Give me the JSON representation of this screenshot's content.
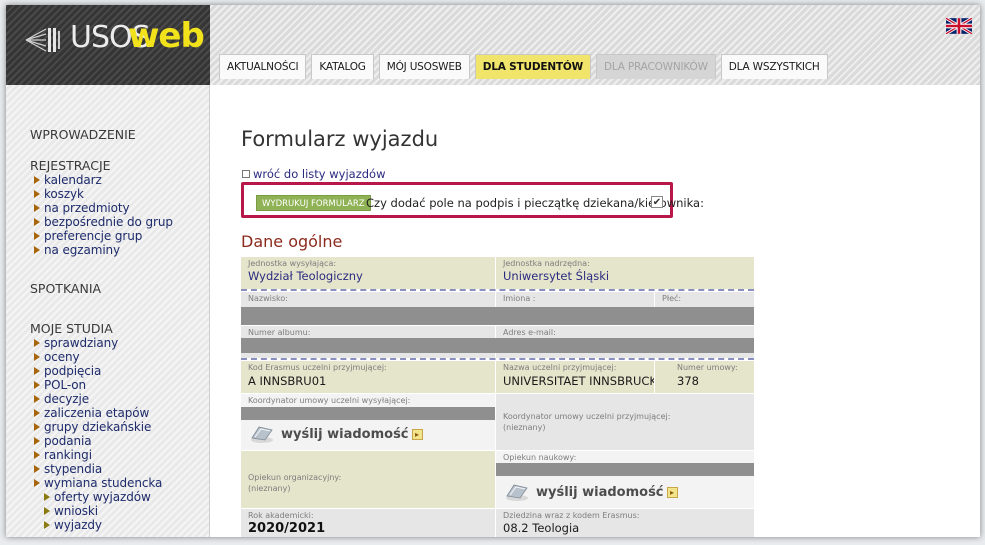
{
  "app": {
    "logo_us": "USOS",
    "logo_web": "web"
  },
  "nav": {
    "tabs": [
      {
        "label": "AKTUALNOŚCI"
      },
      {
        "label": "KATALOG"
      },
      {
        "label": "MÓJ USOSWEB"
      },
      {
        "label": "DLA STUDENTÓW",
        "active": true
      },
      {
        "label": "DLA PRACOWNIKÓW",
        "disabled": true
      },
      {
        "label": "DLA WSZYSTKICH"
      }
    ]
  },
  "sidebar": {
    "wprowadzenie": "WPROWADZENIE",
    "rejestracje": {
      "title": "REJESTRACJE",
      "items": [
        "kalendarz",
        "koszyk",
        "na przedmioty",
        "bezpośrednie do grup",
        "preferencje grup",
        "na egzaminy"
      ]
    },
    "spotkania": "SPOTKANIA",
    "moje_studia": {
      "title": "MOJE STUDIA",
      "items": [
        "sprawdziany",
        "oceny",
        "podpięcia",
        "POL-on",
        "decyzje",
        "zaliczenia etapów",
        "grupy dziekańskie",
        "podania",
        "rankingi",
        "stypendia",
        "wymiana studencka"
      ],
      "sub_items": [
        "oferty wyjazdów",
        "wnioski",
        "wyjazdy"
      ]
    }
  },
  "main": {
    "title": "Formularz wyjazdu",
    "back_link": "wróć do listy wyjazdów",
    "print_button": "WYDRUKUJ FORMULARZ",
    "sign_label": "Czy dodać pole na podpis i pieczątkę dziekana/kierownika:",
    "sign_checked": "✔",
    "section_title": "Dane ogólne",
    "form": {
      "sending_unit_label": "Jednostka wysyłająca:",
      "sending_unit": "Wydział Teologiczny",
      "parent_unit_label": "Jednostka nadrzędna:",
      "parent_unit": "Uniwersytet Śląski",
      "surname_label": "Nazwisko:",
      "names_label": "Imiona :",
      "sex_label": "Płeć:",
      "album_label": "Numer albumu:",
      "email_label": "Adres e-mail:",
      "erasmus_code_label": "Kod Erasmus uczelni przyjmującej:",
      "erasmus_code": "A INNSBRU01",
      "host_name_label": "Nazwa uczelni przyjmującej:",
      "host_name": "UNIVERSITAET INNSBRUCK",
      "agreement_no_label": "Numer umowy:",
      "agreement_no": "378",
      "coord_sending_label": "Koordynator umowy uczelni wysyłającej:",
      "send_message": "wyślij wiadomość",
      "coord_host_label": "Koordynator umowy uczelni przyjmującej:",
      "coord_host_value": "(nieznany)",
      "org_tutor_label": "Opiekun organizacyjny:",
      "org_tutor_value": "(nieznany)",
      "sci_tutor_label": "Opiekun naukowy:",
      "academic_year_label": "Rok akademicki:",
      "academic_year": "2020/2021",
      "field_label": "Dziedzina wraz z kodem Erasmus:",
      "field_value": "08.2 Teologia"
    }
  },
  "colors": {
    "accent_tab": "#f0e46a",
    "logo_yellow": "#f2e21c",
    "highlight_border": "#b8174a",
    "print_button": "#8fb255",
    "section_title": "#8c2b1d",
    "link": "#1e2b6b"
  }
}
